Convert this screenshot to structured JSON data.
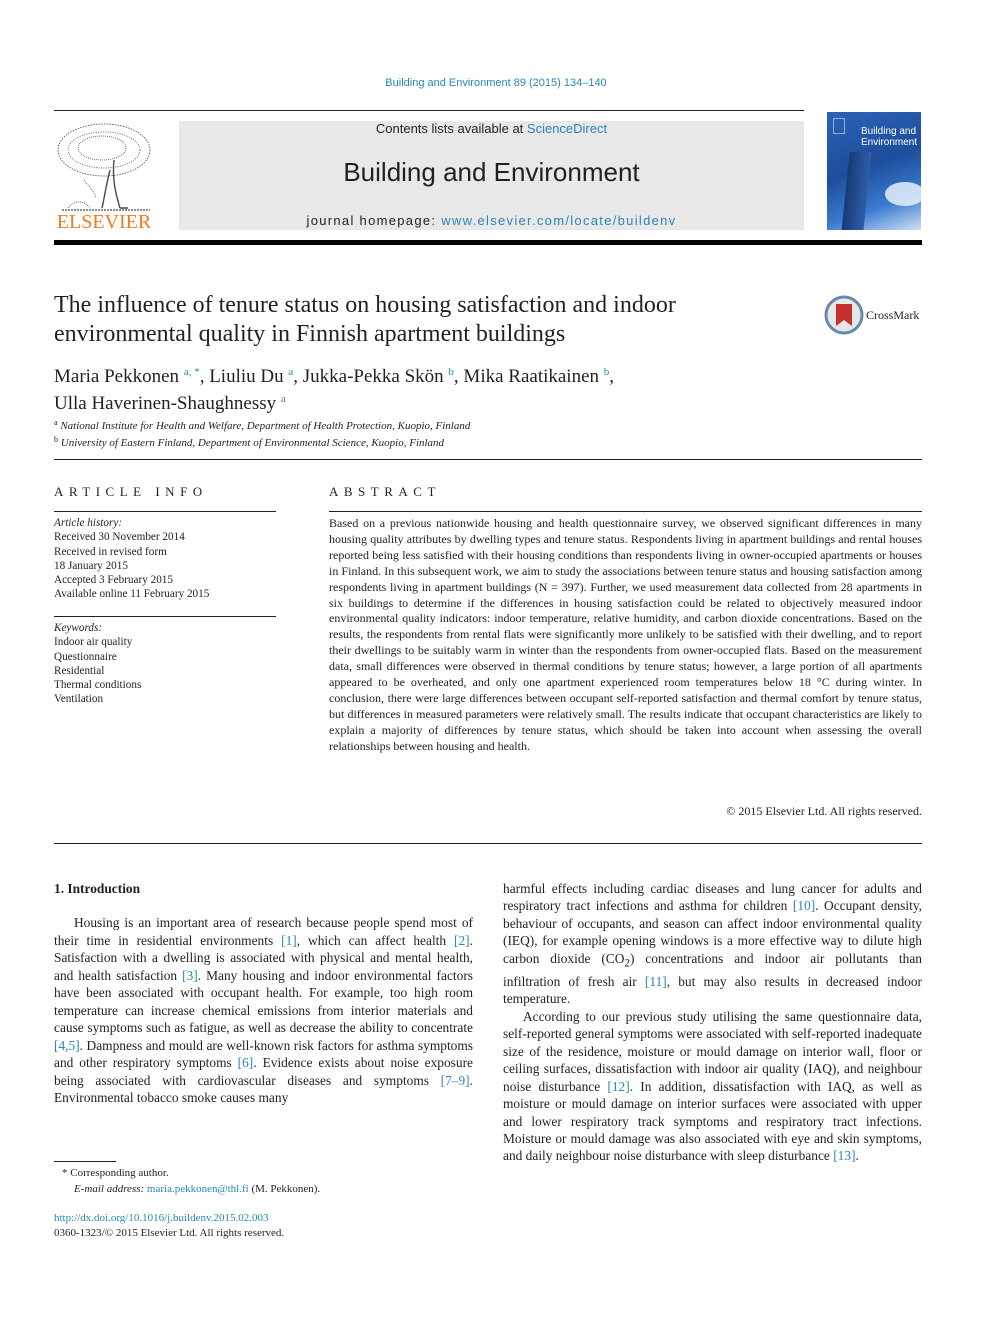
{
  "running_head": "Building and Environment 89 (2015) 134–140",
  "masthead": {
    "contents_prefix": "Contents lists available at ",
    "contents_link": "ScienceDirect",
    "journal_title": "Building and Environment",
    "homepage_prefix": "journal homepage: ",
    "homepage_link": "www.elsevier.com/locate/buildenv",
    "publisher_logo_text": "ELSEVIER",
    "cover_title_line1": "Building and",
    "cover_title_line2": "Environment",
    "brand_color": "#f47920",
    "link_color": "#2a86b8"
  },
  "article": {
    "title": "The influence of tenure status on housing satisfaction and indoor environmental quality in Finnish apartment buildings",
    "crossmark_label": "CrossMark",
    "authors": [
      {
        "name": "Maria Pekkonen",
        "aff": "a, *",
        "sep": ", "
      },
      {
        "name": "Liuliu Du",
        "aff": "a",
        "sep": ", "
      },
      {
        "name": "Jukka-Pekka Skön",
        "aff": "b",
        "sep": ", "
      },
      {
        "name": "Mika Raatikainen",
        "aff": "b",
        "sep": ","
      },
      {
        "name": "Ulla Haverinen-Shaughnessy",
        "aff": "a",
        "sep": ""
      }
    ],
    "affiliations": [
      {
        "mark": "a",
        "text": "National Institute for Health and Welfare, Department of Health Protection, Kuopio, Finland"
      },
      {
        "mark": "b",
        "text": "University of Eastern Finland, Department of Environmental Science, Kuopio, Finland"
      }
    ]
  },
  "article_info": {
    "heading": "ARTICLE INFO",
    "history_label": "Article history:",
    "history": [
      "Received 30 November 2014",
      "Received in revised form",
      "18 January 2015",
      "Accepted 3 February 2015",
      "Available online 11 February 2015"
    ],
    "keywords_label": "Keywords:",
    "keywords": [
      "Indoor air quality",
      "Questionnaire",
      "Residential",
      "Thermal conditions",
      "Ventilation"
    ]
  },
  "abstract": {
    "heading": "ABSTRACT",
    "text": "Based on a previous nationwide housing and health questionnaire survey, we observed significant differences in many housing quality attributes by dwelling types and tenure status. Respondents living in apartment buildings and rental houses reported being less satisfied with their housing conditions than respondents living in owner-occupied apartments or houses in Finland. In this subsequent work, we aim to study the associations between tenure status and housing satisfaction among respondents living in apartment buildings (N = 397). Further, we used measurement data collected from 28 apartments in six buildings to determine if the differences in housing satisfaction could be related to objectively measured indoor environmental quality indicators: indoor temperature, relative humidity, and carbon dioxide concentrations. Based on the results, the respondents from rental flats were significantly more unlikely to be satisfied with their dwelling, and to report their dwellings to be suitably warm in winter than the respondents from owner-occupied flats. Based on the measurement data, small differences were observed in thermal conditions by tenure status; however, a large portion of all apartments appeared to be overheated, and only one apartment experienced room temperatures below 18 °C during winter. In conclusion, there were large differences between occupant self-reported satisfaction and thermal comfort by tenure status, but differences in measured parameters were relatively small. The results indicate that occupant characteristics are likely to explain a majority of differences by tenure status, which should be taken into account when assessing the overall relationships between housing and health.",
    "copyright": "© 2015 Elsevier Ltd. All rights reserved."
  },
  "body": {
    "section_heading": "1.  Introduction",
    "left_para": [
      {
        "t": "Housing is an important area of research because people spend most of their time in residential environments "
      },
      {
        "r": "[1]"
      },
      {
        "t": ", which can affect health "
      },
      {
        "r": "[2]"
      },
      {
        "t": ". Satisfaction with a dwelling is associated with physical and mental health, and health satisfaction "
      },
      {
        "r": "[3]"
      },
      {
        "t": ". Many housing and indoor environmental factors have been associated with occupant health. For example, too high room temperature can increase chemical emissions from interior materials and cause symptoms such as fatigue, as well as decrease the ability to concentrate "
      },
      {
        "r": "[4,5]"
      },
      {
        "t": ". Dampness and mould are well-known risk factors for asthma symptoms and other respiratory symptoms "
      },
      {
        "r": "[6]"
      },
      {
        "t": ". Evidence exists about noise exposure being associated with cardiovascular diseases and symptoms "
      },
      {
        "r": "[7–9]"
      },
      {
        "t": ". Environmental tobacco smoke causes many"
      }
    ],
    "right_para1": [
      {
        "t": "harmful effects including cardiac diseases and lung cancer for adults and respiratory tract infections and asthma for children "
      },
      {
        "r": "[10]"
      },
      {
        "t": ". Occupant density, behaviour of occupants, and season can affect indoor environmental quality (IEQ), for example opening windows is a more effective way to dilute high carbon dioxide (CO"
      },
      {
        "sub": "2"
      },
      {
        "t": ") concentrations and indoor air pollutants than infiltration of fresh air "
      },
      {
        "r": "[11]"
      },
      {
        "t": ", but may also results in decreased indoor temperature."
      }
    ],
    "right_para2": [
      {
        "t": "According to our previous study utilising the same questionnaire data, self-reported general symptoms were associated with self-reported inadequate size of the residence, moisture or mould damage on interior wall, floor or ceiling surfaces, dissatisfaction with indoor air quality (IAQ), and neighbour noise disturbance "
      },
      {
        "r": "[12]"
      },
      {
        "t": ". In addition, dissatisfaction with IAQ, as well as moisture or mould damage on interior surfaces were associated with upper and lower respiratory track symptoms and respiratory tract infections. Moisture or mould damage was also associated with eye and skin symptoms, and daily neighbour noise disturbance with sleep disturbance "
      },
      {
        "r": "[13]"
      },
      {
        "t": "."
      }
    ]
  },
  "footnote": {
    "star": "*",
    "corresponding": "Corresponding author.",
    "email_label": "E-mail address:",
    "email": "maria.pekkonen@thl.fi",
    "email_suffix": " (M. Pekkonen)."
  },
  "doi": {
    "url": "http://dx.doi.org/10.1016/j.buildenv.2015.02.003",
    "issn_line": "0360-1323/© 2015 Elsevier Ltd. All rights reserved."
  }
}
